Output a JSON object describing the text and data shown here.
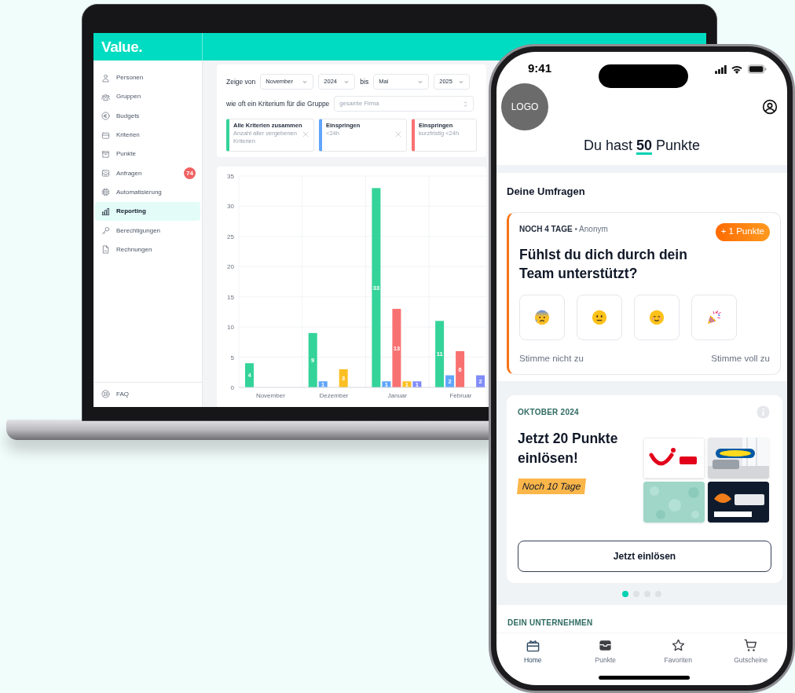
{
  "laptop": {
    "logo": "Value.",
    "sidebar": [
      {
        "label": "Personen",
        "selected": false
      },
      {
        "label": "Gruppen",
        "selected": false
      },
      {
        "label": "Budgets",
        "selected": false
      },
      {
        "label": "Kriterien",
        "selected": false
      },
      {
        "label": "Punkte",
        "selected": false
      },
      {
        "label": "Anfragen",
        "selected": false,
        "badge": "74"
      },
      {
        "label": "Automatisierung",
        "selected": false
      },
      {
        "label": "Reporting",
        "selected": true
      },
      {
        "label": "Berechtigungen",
        "selected": false
      },
      {
        "label": "Rechnungen",
        "selected": false
      }
    ],
    "footer_item": "FAQ",
    "filters": {
      "from_label": "Zeige von",
      "from_month": "November",
      "from_year": "2024",
      "to_label": "bis",
      "to_month": "Mai",
      "to_year": "2025",
      "group_label": "wie oft ein Kriterium für die Gruppe",
      "group_value": "gesamte Firma"
    },
    "criteria": [
      {
        "title": "Alle Kriterien zusammen",
        "subtitle": "Anzahl aller vergebenen Kriterien",
        "color": "#34d399",
        "removable": true
      },
      {
        "title": "Einspringen",
        "subtitle": "<24h",
        "color": "#60a5fa",
        "removable": true
      },
      {
        "title": "Einspringen",
        "subtitle": "kurzfristig <24h",
        "color": "#f87171",
        "removable": false
      }
    ],
    "chart_data": {
      "type": "bar",
      "categories": [
        "November",
        "Dezember",
        "Januar",
        "Februar"
      ],
      "series": [
        {
          "color": "#34d399",
          "values": [
            4,
            9,
            33,
            11
          ]
        },
        {
          "color": "#60a5fa",
          "values": [
            null,
            1,
            1,
            2
          ]
        },
        {
          "color": "#f87171",
          "values": [
            null,
            null,
            13,
            6
          ]
        },
        {
          "color": "#fbbf24",
          "values": [
            null,
            3,
            1,
            null
          ]
        },
        {
          "color": "#818cf8",
          "values": [
            null,
            null,
            1,
            2
          ]
        }
      ],
      "grid": true,
      "ylim": [
        0,
        35
      ],
      "yticks": [
        0,
        5,
        10,
        15,
        20,
        25,
        30,
        35
      ],
      "data_labels": true
    }
  },
  "phone": {
    "status_bar": {
      "time": "9:41"
    },
    "logo": "LOGO",
    "points_text": "Du hast **50** Punkte",
    "surveys": {
      "title": "Deine Umfragen",
      "items": [
        {
          "meta": "**NOCH 4 TAGE** • Anonym",
          "reward": "+ 1 Punkte",
          "question": "Fühlst du dich durch dein Team unterstützt?",
          "scale_min": "Stimme nicht zu",
          "scale_max": "Stimme voll zu"
        }
      ]
    },
    "promo": {
      "label": "OKTOBER 2024",
      "title": "Jetzt 20 Punkte einlösen!",
      "tag": "Noch 10 Tage",
      "button": "Jetzt einlösen",
      "pages": [
        {
          "selected": true
        },
        {
          "selected": false
        },
        {
          "selected": false
        },
        {
          "selected": false
        }
      ]
    },
    "company_section": {
      "title": "DEIN UNTERNEHMEN"
    },
    "tab_bar": [
      {
        "label": "Home",
        "selected": true
      },
      {
        "label": "Punkte",
        "selected": false
      },
      {
        "label": "Favoriten",
        "selected": false
      },
      {
        "label": "Gutscheine",
        "selected": false
      }
    ]
  }
}
